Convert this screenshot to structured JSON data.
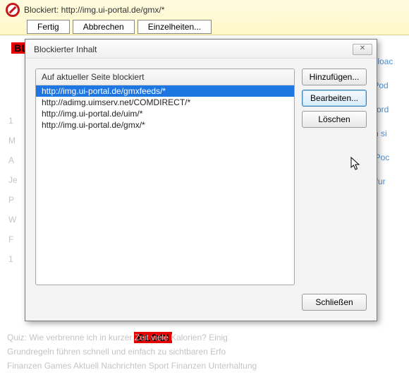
{
  "topbar": {
    "label": "Blockiert: http://img.ui-portal.de/gmx/*",
    "buttons": {
      "done": "Fertig",
      "cancel": "Abbrechen",
      "details": "Einzelheiten..."
    }
  },
  "dialog": {
    "title": "Blockierter Inhalt",
    "list_header": "Auf aktueller Seite blockiert",
    "items": [
      "http://img.ui-portal.de/gmxfeeds/*",
      "http://adimg.uimserv.net/COMDIRECT/*",
      "http://img.ui-portal.de/uim/*",
      "http://img.ui-portal.de/gmx/*"
    ],
    "selected_index": 0,
    "buttons": {
      "add": "Hinzufügen...",
      "edit": "Bearbeiten...",
      "delete": "Löschen",
      "close": "Schließen"
    }
  },
  "background": {
    "tag_cut": "BL",
    "tag_full": "BLOCI",
    "right_links": [
      "wnloac",
      ", iPod",
      "Alford",
      "ton si",
      "'s Poc",
      "fs fur"
    ],
    "left_letters": [
      "1",
      "M",
      "A",
      "Je",
      "P",
      "W",
      "F",
      "1"
    ],
    "bottom_lines": [
      "Quiz: Wie verbrenne ich in kurzer Zeit viele Kalorien? Einig",
      "Grundregeln führen schnell und einfach zu sichtbaren Erfo"
    ],
    "bottom_menu": [
      "Finanzen",
      "Games",
      "Aktuell",
      "Nachrichten",
      "Sport",
      "Finanzen",
      "Unterhaltung"
    ]
  }
}
